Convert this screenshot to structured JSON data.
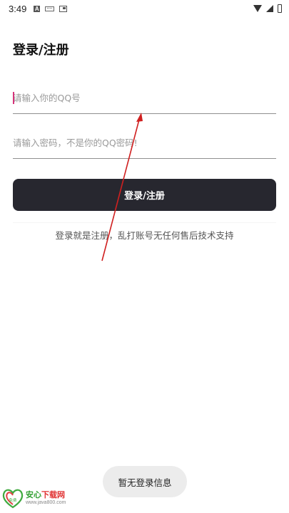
{
  "status_bar": {
    "time": "3:49",
    "a_badge": "A"
  },
  "page": {
    "title": "登录/注册"
  },
  "form": {
    "qq_placeholder": "请输入你的QQ号",
    "password_placeholder": "请输入密码，不是你的QQ密码!",
    "submit_label": "登录/注册",
    "disclaimer": "登录就是注册，乱打账号无任何售后技术支持"
  },
  "toast": {
    "message": "暂无登录信息"
  },
  "watermark": {
    "brand_part1": "安心",
    "brand_part2": "下载网",
    "url": "www.java800.com",
    "badge": "免费"
  },
  "colors": {
    "button_bg": "#27272f",
    "arrow": "#d02020",
    "caret": "#d6337a"
  }
}
